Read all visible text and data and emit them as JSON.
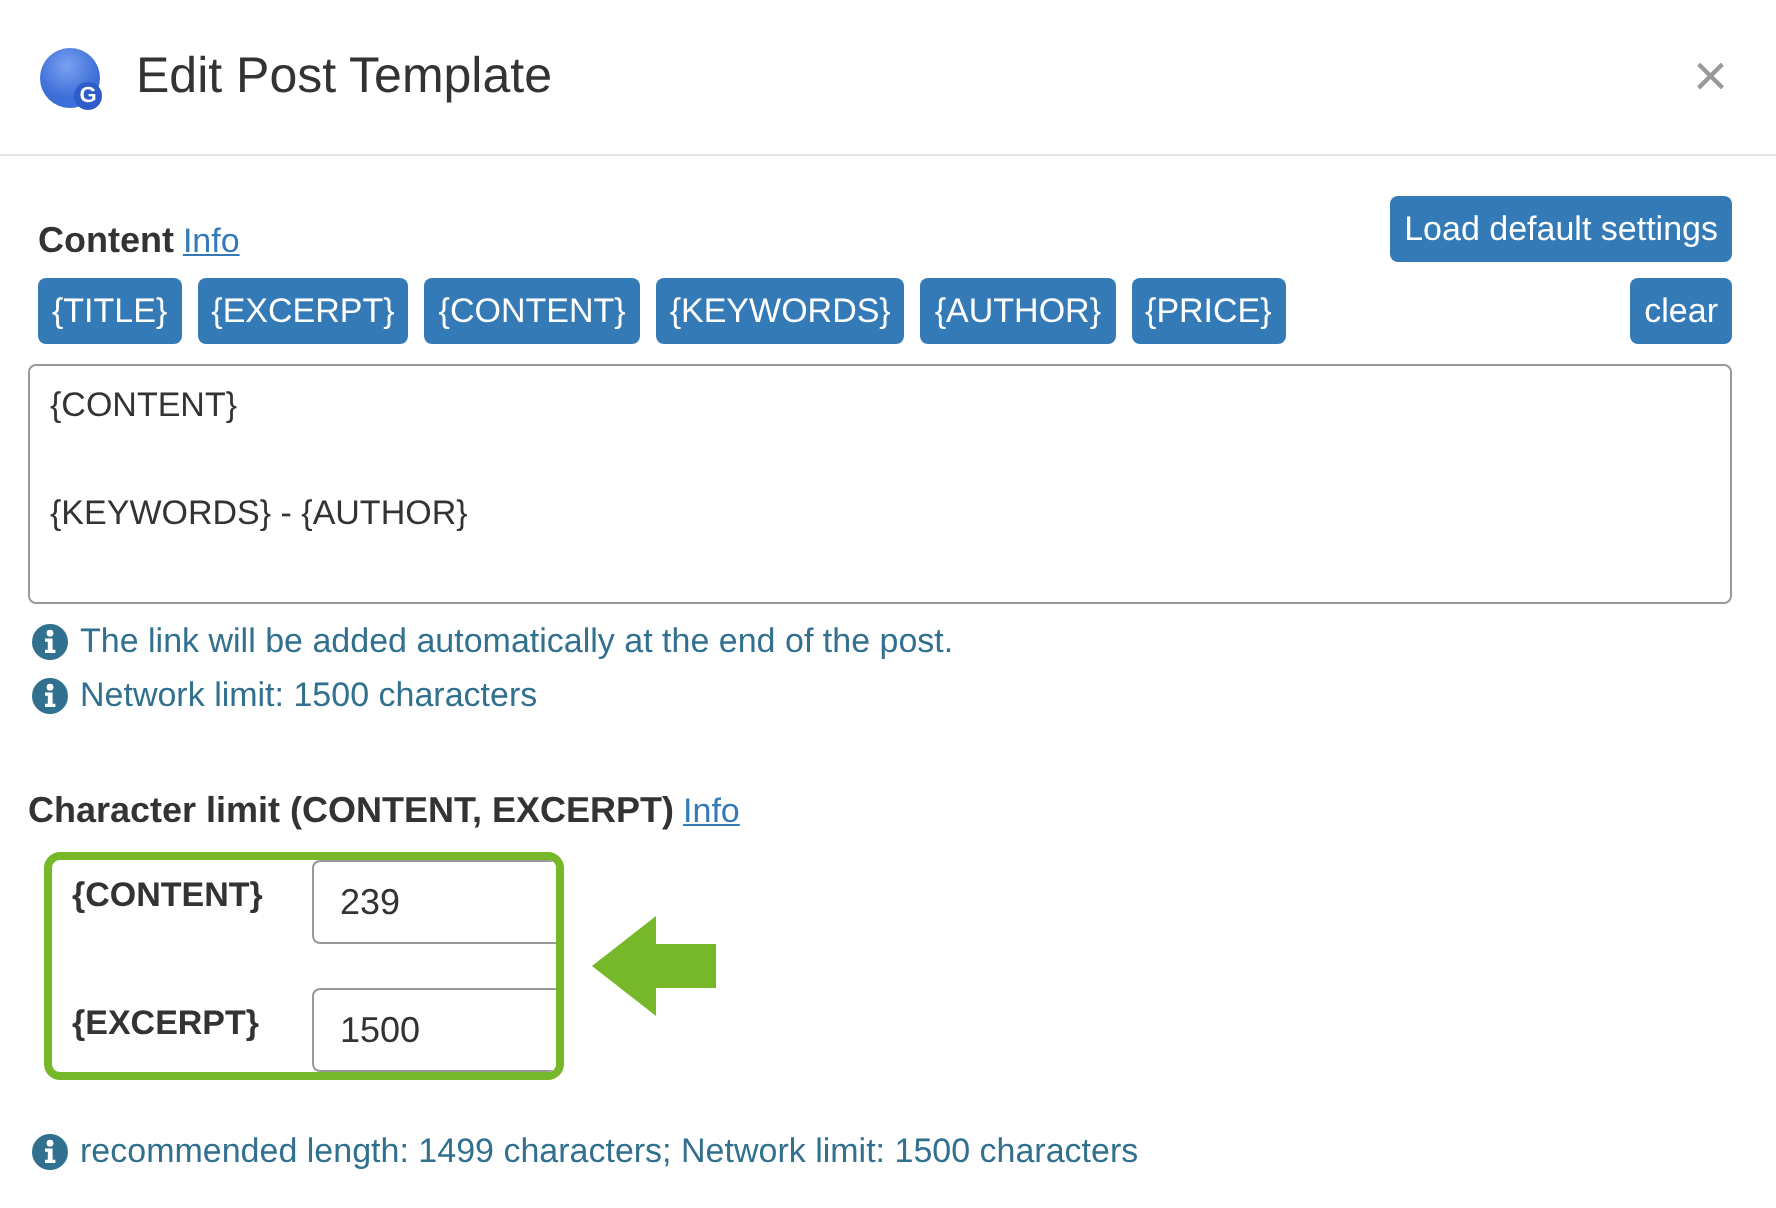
{
  "dialog": {
    "logo_letter": "G",
    "title": "Edit Post Template",
    "close": "×"
  },
  "content": {
    "label": "Content",
    "info_link": "Info",
    "load_button": "Load default settings",
    "placeholders": [
      "{TITLE}",
      "{EXCERPT}",
      "{CONTENT}",
      "{KEYWORDS}",
      "{AUTHOR}",
      "{PRICE}"
    ],
    "clear_button": "clear",
    "value": "{CONTENT}\n\n{KEYWORDS} - {AUTHOR}",
    "notes": [
      "The link will be added automatically at the end of the post.",
      "Network limit: 1500 characters"
    ]
  },
  "character_limit": {
    "label": "Character limit (CONTENT, EXCERPT)",
    "info_link": "Info",
    "fields": [
      {
        "label": "{CONTENT}",
        "value": "239"
      },
      {
        "label": "{EXCERPT}",
        "value": "1500"
      }
    ],
    "note": "recommended length: 1499 characters; Network limit: 1500 characters"
  }
}
